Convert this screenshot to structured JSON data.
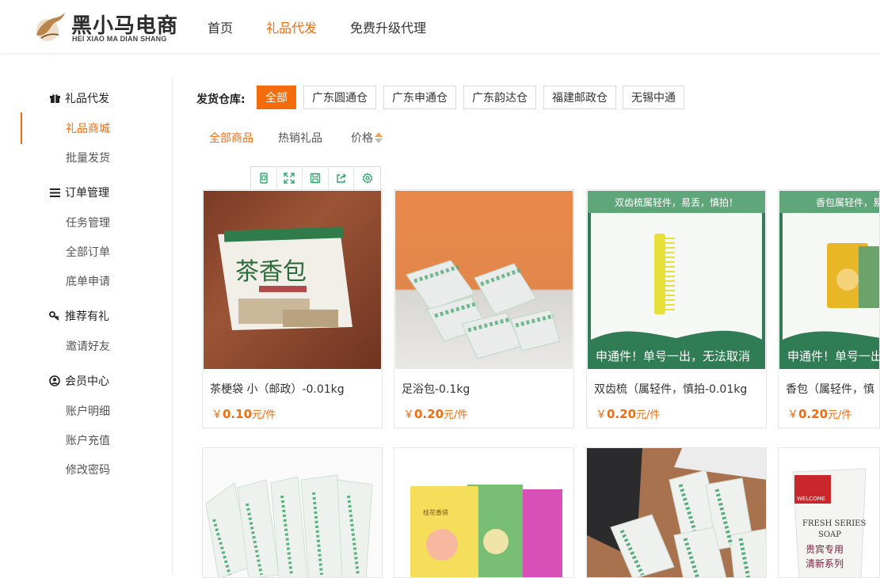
{
  "header": {
    "logo_cn": "黑小马电商",
    "logo_en": "HEI XIAO MA DIAN SHANG",
    "nav": [
      {
        "label": "首页"
      },
      {
        "label": "礼品代发"
      },
      {
        "label": "免费升级代理"
      }
    ]
  },
  "sidebar": {
    "groups": [
      {
        "title": "礼品代发",
        "items": [
          "礼品商城",
          "批量发货"
        ]
      },
      {
        "title": "订单管理",
        "items": [
          "任务管理",
          "全部订单",
          "底单申请"
        ]
      },
      {
        "title": "推荐有礼",
        "items": [
          "邀请好友"
        ]
      },
      {
        "title": "会员中心",
        "items": [
          "账户明细",
          "账户充值",
          "修改密码"
        ]
      }
    ]
  },
  "filter": {
    "label": "发货仓库:",
    "warehouses": [
      "全部",
      "广东圆通仓",
      "广东申通仓",
      "广东韵达仓",
      "福建邮政仓",
      "无锡中通"
    ]
  },
  "tabs": [
    "全部商品",
    "热销礼品",
    "价格"
  ],
  "products": [
    {
      "name": "茶梗袋 小（邮政）-0.01kg",
      "currency": "￥",
      "price": "0.10",
      "unit": "元/件"
    },
    {
      "name": "足浴包-0.1kg",
      "currency": "￥",
      "price": "0.20",
      "unit": "元/件"
    },
    {
      "name": "双齿梳（属轻件，慎拍-0.01kg",
      "currency": "￥",
      "price": "0.20",
      "unit": "元/件"
    },
    {
      "name": "香包（属轻件，慎",
      "currency": "￥",
      "price": "0.20",
      "unit": "元/件"
    }
  ],
  "image_text": {
    "comb_banner": "双齿梳属轻件，易丢，慎拍！",
    "sachet_banner": "香包属轻件，易",
    "shentong_notice": "申通件！单号一出，无法取消",
    "shentong_notice_short": "申通件！单号一出",
    "tea_pack": "茶香包",
    "sachet_pack": "桂花香袋",
    "soap_brand": "FRESH SERIES",
    "soap_word": "SOAP",
    "soap_cn": "贵宾专用",
    "soap_cn2": "清新系列",
    "soap_red": "WELCOME"
  },
  "colors": {
    "accent": "#f56c0c",
    "toolbar_icon": "#2fa86b",
    "banner_green": "#2f7c55"
  }
}
